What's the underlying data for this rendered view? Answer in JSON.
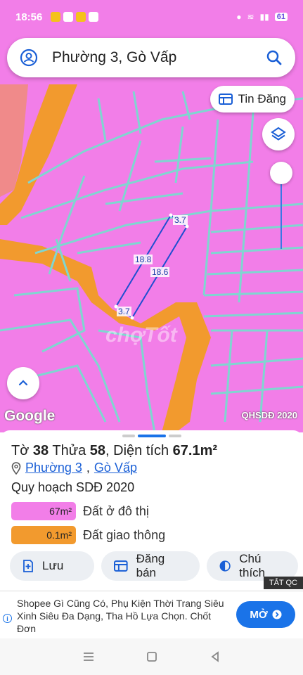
{
  "status_bar": {
    "time": "18:56",
    "battery": "61"
  },
  "search": {
    "text": "Phường 3, Gò Vấp"
  },
  "map": {
    "tin_dang_label": "Tin Đăng",
    "google_label": "Google",
    "layer_label": "QHSDĐ 2020",
    "watermark": "chợTốt",
    "dimensions": {
      "top": "3.7",
      "bottom": "3.7",
      "left": "18.8",
      "right": "18.6"
    },
    "colors": {
      "land": "#f27ee8",
      "road": "#f29a2e",
      "lines": "#7fd6d0",
      "parcel": "#1e4fd0"
    }
  },
  "parcel": {
    "to_label": "Tờ",
    "to_value": "38",
    "thua_label": "Thửa",
    "thua_value": "58",
    "area_label": "Diện tích",
    "area_value": "67.1m²",
    "ward": "Phường 3",
    "district": "Gò Vấp",
    "plan_title": "Quy hoạch SDĐ 2020"
  },
  "legend": [
    {
      "value": "67m²",
      "label": "Đất ở đô thị",
      "color": "#f27ee8"
    },
    {
      "value": "0.1m²",
      "label": "Đất giao thông",
      "color": "#f29a2e"
    }
  ],
  "actions": {
    "save": "Lưu",
    "post": "Đăng bán",
    "note": "Chú thích"
  },
  "ad": {
    "hide_label": "TẮT QC",
    "text": "Shopee Gì Cũng Có, Phụ Kiện Thời Trang Siêu Xinh Siêu Đa Dạng, Tha Hồ Lựa Chọn. Chốt Đơn",
    "button": "MỞ"
  }
}
